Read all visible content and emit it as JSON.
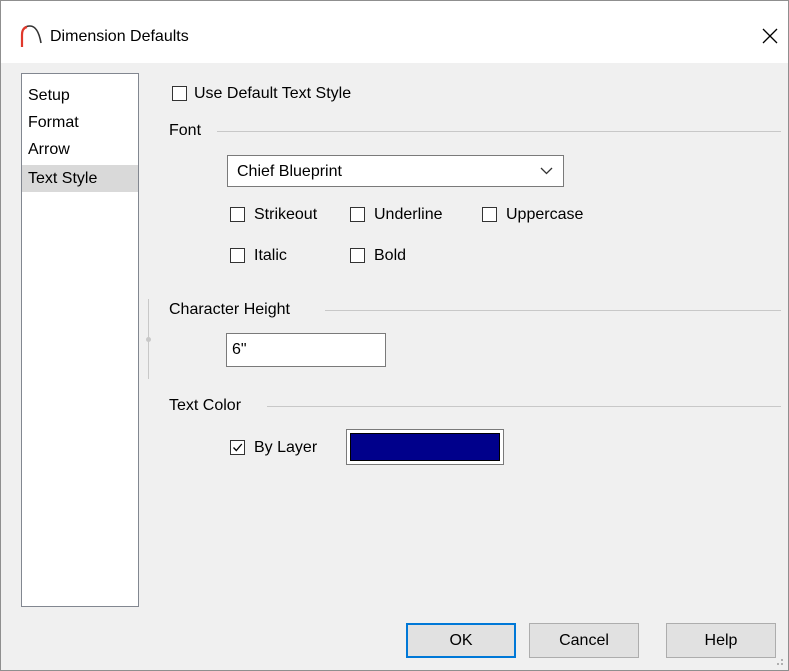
{
  "window": {
    "title": "Dimension Defaults",
    "close_symbol": "✕",
    "icon": "chief-architect-logo-icon",
    "icon_color": "#e0382b"
  },
  "nav": {
    "items": [
      {
        "label": "Setup",
        "selected": false
      },
      {
        "label": "Format",
        "selected": false
      },
      {
        "label": "Arrow",
        "selected": false
      },
      {
        "label": "Text Style",
        "selected": true
      }
    ]
  },
  "use_default": {
    "label": "Use Default Text Style",
    "checked": false
  },
  "font": {
    "section_label": "Font",
    "selected_font": "Chief Blueprint",
    "options": {
      "strikeout": {
        "label": "Strikeout",
        "checked": false
      },
      "underline": {
        "label": "Underline",
        "checked": false
      },
      "uppercase": {
        "label": "Uppercase",
        "checked": false
      },
      "italic": {
        "label": "Italic",
        "checked": false
      },
      "bold": {
        "label": "Bold",
        "checked": false
      }
    }
  },
  "character_height": {
    "section_label": "Character Height",
    "value": "6\""
  },
  "text_color": {
    "section_label": "Text Color",
    "by_layer": {
      "label": "By Layer",
      "checked": true
    },
    "swatch_color": "#00008b"
  },
  "buttons": {
    "ok": "OK",
    "cancel": "Cancel",
    "help": "Help"
  }
}
